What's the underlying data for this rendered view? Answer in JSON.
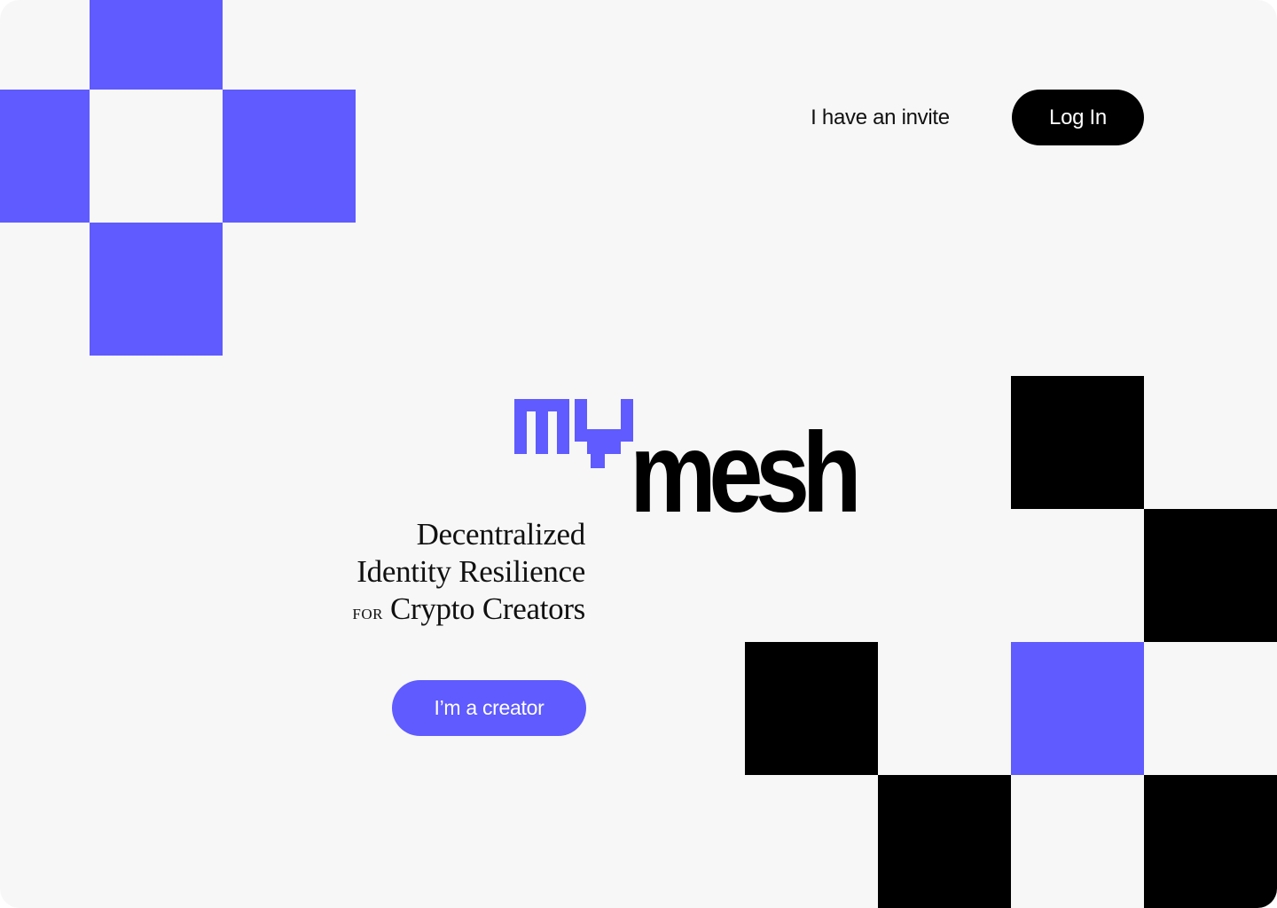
{
  "header": {
    "invite_link": "I have an invite",
    "login_button": "Log In"
  },
  "logo": {
    "prefix_glyph": "my",
    "wordmark": "mesh"
  },
  "hero": {
    "tagline_line1": "Decentralized",
    "tagline_line2": "Identity Resilience",
    "tagline_for": "FOR",
    "tagline_line3": "Crypto Creators",
    "cta_button": "I’m a creator"
  },
  "colors": {
    "accent": "#5f5bff",
    "background": "#f7f7f7",
    "ink": "#000000"
  }
}
